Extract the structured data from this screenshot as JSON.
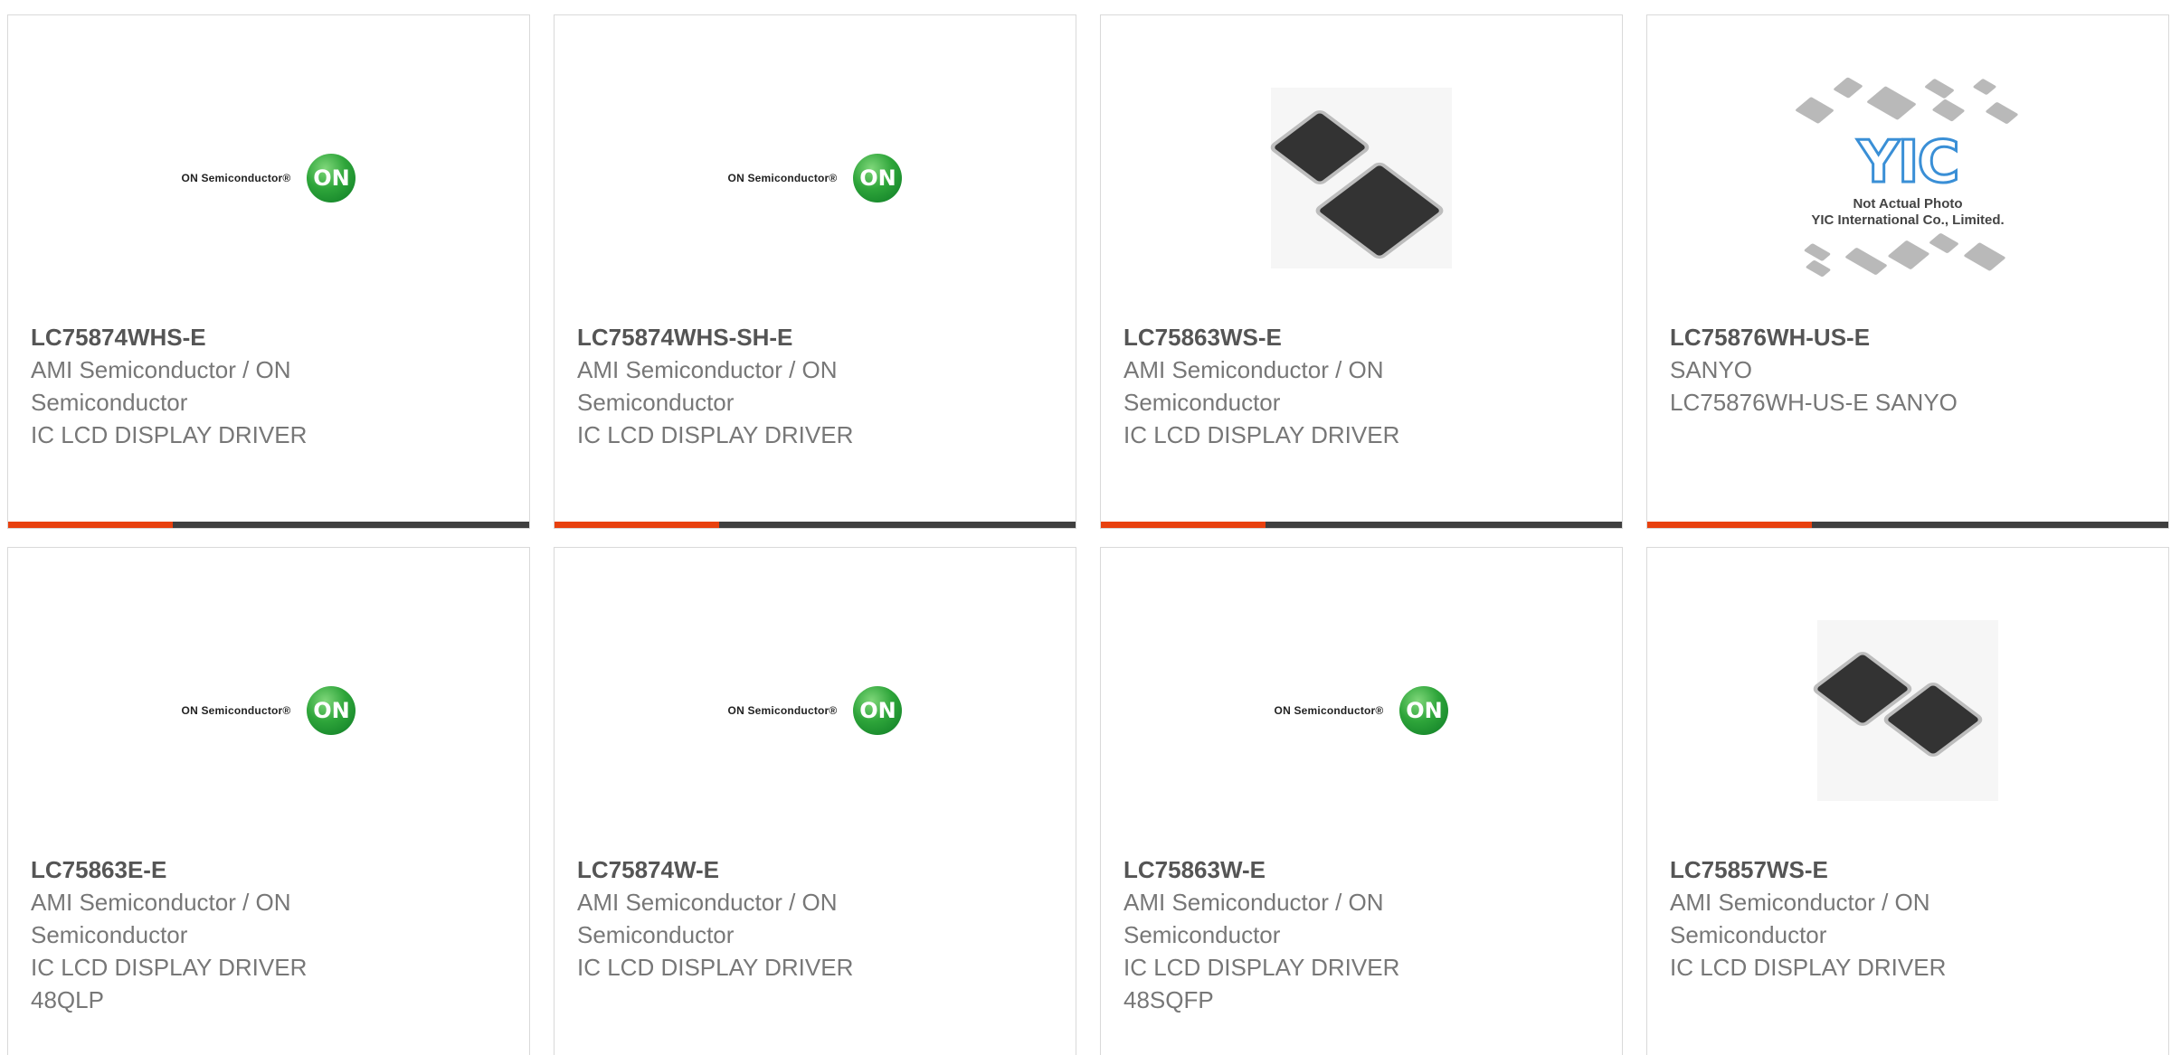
{
  "products": [
    {
      "part": "LC75874WHS-E",
      "manufacturer": "AMI Semiconductor / ON",
      "manufacturer_cont": "Semiconductor",
      "description": "IC LCD DISPLAY DRIVER",
      "package": "",
      "image": "on-semiconductor-logo"
    },
    {
      "part": "LC75874WHS-SH-E",
      "manufacturer": "AMI Semiconductor / ON",
      "manufacturer_cont": "Semiconductor",
      "description": "IC LCD DISPLAY DRIVER",
      "package": "",
      "image": "on-semiconductor-logo"
    },
    {
      "part": "LC75863WS-E",
      "manufacturer": "AMI Semiconductor / ON",
      "manufacturer_cont": "Semiconductor",
      "description": "IC LCD DISPLAY DRIVER",
      "package": "",
      "image": "qfp-chip-photo"
    },
    {
      "part": "LC75876WH-US-E",
      "manufacturer": "SANYO",
      "manufacturer_cont": "LC75876WH-US-E SANYO",
      "description": "",
      "package": "",
      "image": "yic-placeholder"
    },
    {
      "part": "LC75863E-E",
      "manufacturer": "AMI Semiconductor / ON",
      "manufacturer_cont": "Semiconductor",
      "description": "IC LCD DISPLAY DRIVER",
      "package": "48QLP",
      "image": "on-semiconductor-logo"
    },
    {
      "part": "LC75874W-E",
      "manufacturer": "AMI Semiconductor / ON",
      "manufacturer_cont": "Semiconductor",
      "description": "IC LCD DISPLAY DRIVER",
      "package": "",
      "image": "on-semiconductor-logo"
    },
    {
      "part": "LC75863W-E",
      "manufacturer": "AMI Semiconductor / ON",
      "manufacturer_cont": "Semiconductor",
      "description": "IC LCD DISPLAY DRIVER",
      "package": "48SQFP",
      "image": "on-semiconductor-logo"
    },
    {
      "part": "LC75857WS-E",
      "manufacturer": "AMI Semiconductor / ON",
      "manufacturer_cont": "Semiconductor",
      "description": "IC LCD DISPLAY DRIVER",
      "package": "",
      "image": "qfp-chip-photo"
    }
  ],
  "logo": {
    "on_text": "ON Semiconductor®",
    "on_badge": "ON"
  },
  "yic": {
    "mark": "YIC",
    "caption_line1": "Not Actual Photo",
    "caption_line2": "YIC International Co., Limited."
  },
  "colors": {
    "accent": "#e8410f",
    "bar": "#3f3f3f",
    "on_green": "#2ea53a",
    "yic_blue": "#3a8fd6"
  }
}
